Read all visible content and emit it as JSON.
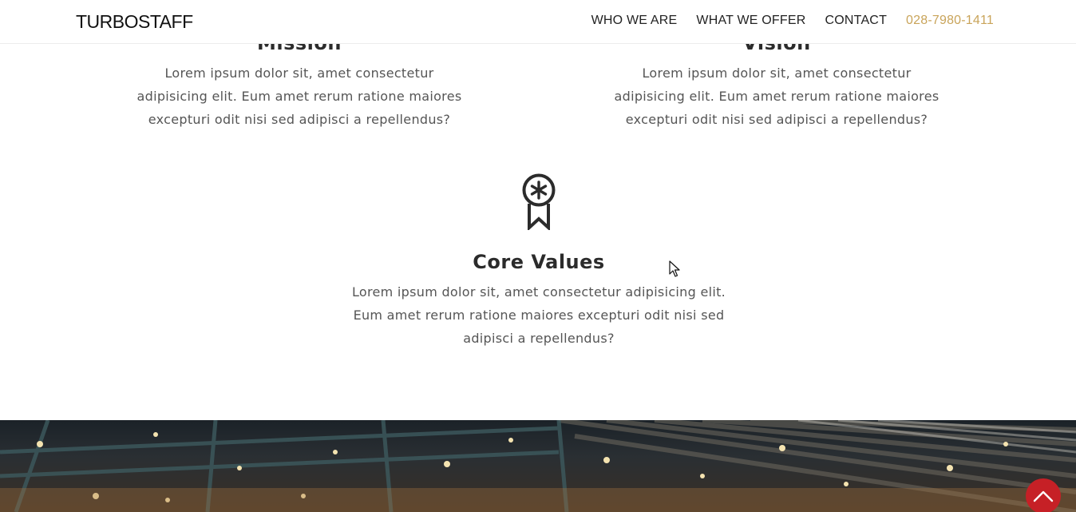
{
  "header": {
    "logo": "TURBOSTAFF",
    "nav": [
      {
        "label": "WHO WE ARE"
      },
      {
        "label": "WHAT WE OFFER"
      },
      {
        "label": "CONTACT"
      },
      {
        "label": "028-7980-1411"
      }
    ]
  },
  "features": {
    "mission": {
      "title": "Mission",
      "text": "Lorem ipsum dolor sit, amet consectetur adipisicing elit. Eum amet rerum ratione maiores excepturi odit nisi sed adipisci a repellendus?"
    },
    "vision": {
      "title": "Vision",
      "text": "Lorem ipsum dolor sit, amet consectetur adipisicing elit. Eum amet rerum ratione maiores excepturi odit nisi sed adipisci a repellendus?"
    },
    "core": {
      "icon": "award-ribbon-icon",
      "title": "Core Values",
      "text": "Lorem ipsum dolor sit, amet consectetur adipisicing elit. Eum amet rerum ratione maiores excepturi odit nisi sed adipisci a repellendus?"
    }
  },
  "scroll_top": {
    "icon": "chevron-up-icon"
  },
  "colors": {
    "accent_phone": "#c9a45a",
    "scroll_top_bg": "#c62026"
  }
}
